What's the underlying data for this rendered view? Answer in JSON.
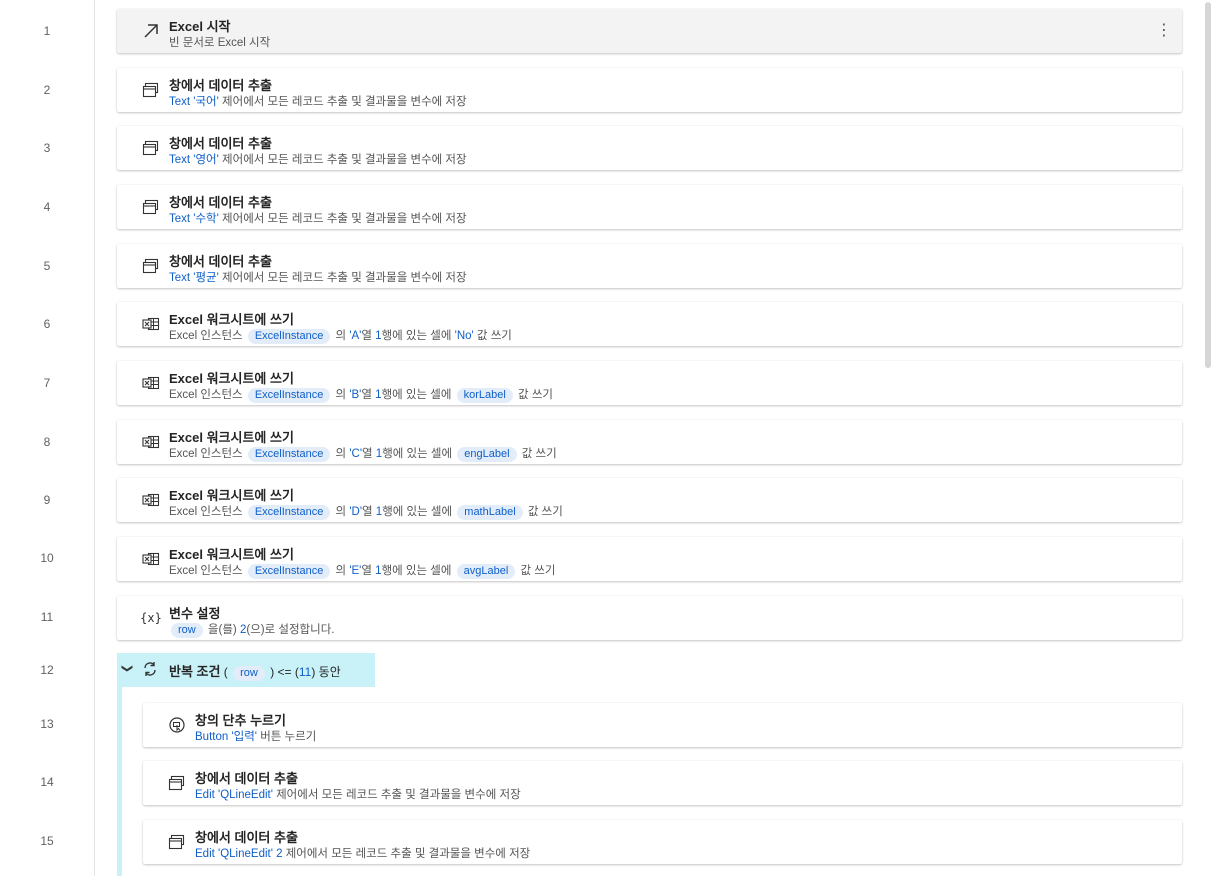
{
  "line_numbers": [
    "1",
    "2",
    "3",
    "4",
    "5",
    "6",
    "7",
    "8",
    "9",
    "10",
    "11",
    "12",
    "13",
    "14",
    "15"
  ],
  "actions": [
    {
      "title": "Excel 시작",
      "icon": "launch-arrow-icon",
      "desc": [
        {
          "t": "text",
          "v": "빈 문서로 Excel 시작"
        }
      ]
    },
    {
      "title": "창에서 데이터 추출",
      "icon": "window-icon",
      "desc": [
        {
          "t": "blue",
          "v": "Text '국어'"
        },
        {
          "t": "text",
          "v": " 제어에서 모든 레코드 추출 및 결과물을  변수에 저장"
        }
      ]
    },
    {
      "title": "창에서 데이터 추출",
      "icon": "window-icon",
      "desc": [
        {
          "t": "blue",
          "v": "Text '영어'"
        },
        {
          "t": "text",
          "v": " 제어에서 모든 레코드 추출 및 결과물을  변수에 저장"
        }
      ]
    },
    {
      "title": "창에서 데이터 추출",
      "icon": "window-icon",
      "desc": [
        {
          "t": "blue",
          "v": "Text '수학'"
        },
        {
          "t": "text",
          "v": " 제어에서 모든 레코드 추출 및 결과물을  변수에 저장"
        }
      ]
    },
    {
      "title": "창에서 데이터 추출",
      "icon": "window-icon",
      "desc": [
        {
          "t": "blue",
          "v": "Text '평균'"
        },
        {
          "t": "text",
          "v": " 제어에서 모든 레코드 추출 및 결과물을  변수에 저장"
        }
      ]
    },
    {
      "title": "Excel 워크시트에 쓰기",
      "icon": "excel-icon",
      "desc": [
        {
          "t": "text",
          "v": "Excel 인스턴스 "
        },
        {
          "t": "chip",
          "v": "ExcelInstance"
        },
        {
          "t": "text",
          "v": " 의 "
        },
        {
          "t": "blue",
          "v": "'A'"
        },
        {
          "t": "text",
          "v": "열 "
        },
        {
          "t": "blue",
          "v": "1"
        },
        {
          "t": "text",
          "v": "행에 있는 셀에 "
        },
        {
          "t": "blue",
          "v": "'No'"
        },
        {
          "t": "text",
          "v": " 값 쓰기"
        }
      ]
    },
    {
      "title": "Excel 워크시트에 쓰기",
      "icon": "excel-icon",
      "desc": [
        {
          "t": "text",
          "v": "Excel 인스턴스 "
        },
        {
          "t": "chip",
          "v": "ExcelInstance"
        },
        {
          "t": "text",
          "v": " 의 "
        },
        {
          "t": "blue",
          "v": "'B'"
        },
        {
          "t": "text",
          "v": "열 "
        },
        {
          "t": "blue",
          "v": "1"
        },
        {
          "t": "text",
          "v": "행에 있는 셀에 "
        },
        {
          "t": "chip",
          "v": "korLabel"
        },
        {
          "t": "text",
          "v": " 값 쓰기"
        }
      ]
    },
    {
      "title": "Excel 워크시트에 쓰기",
      "icon": "excel-icon",
      "desc": [
        {
          "t": "text",
          "v": "Excel 인스턴스 "
        },
        {
          "t": "chip",
          "v": "ExcelInstance"
        },
        {
          "t": "text",
          "v": " 의 "
        },
        {
          "t": "blue",
          "v": "'C'"
        },
        {
          "t": "text",
          "v": "열 "
        },
        {
          "t": "blue",
          "v": "1"
        },
        {
          "t": "text",
          "v": "행에 있는 셀에 "
        },
        {
          "t": "chip",
          "v": "engLabel"
        },
        {
          "t": "text",
          "v": " 값 쓰기"
        }
      ]
    },
    {
      "title": "Excel 워크시트에 쓰기",
      "icon": "excel-icon",
      "desc": [
        {
          "t": "text",
          "v": "Excel 인스턴스 "
        },
        {
          "t": "chip",
          "v": "ExcelInstance"
        },
        {
          "t": "text",
          "v": " 의 "
        },
        {
          "t": "blue",
          "v": "'D'"
        },
        {
          "t": "text",
          "v": "열 "
        },
        {
          "t": "blue",
          "v": "1"
        },
        {
          "t": "text",
          "v": "행에 있는 셀에 "
        },
        {
          "t": "chip",
          "v": "mathLabel"
        },
        {
          "t": "text",
          "v": " 값 쓰기"
        }
      ]
    },
    {
      "title": "Excel 워크시트에 쓰기",
      "icon": "excel-icon",
      "desc": [
        {
          "t": "text",
          "v": "Excel 인스턴스 "
        },
        {
          "t": "chip",
          "v": "ExcelInstance"
        },
        {
          "t": "text",
          "v": " 의 "
        },
        {
          "t": "blue",
          "v": "'E'"
        },
        {
          "t": "text",
          "v": "열 "
        },
        {
          "t": "blue",
          "v": "1"
        },
        {
          "t": "text",
          "v": "행에 있는 셀에 "
        },
        {
          "t": "chip",
          "v": "avgLabel"
        },
        {
          "t": "text",
          "v": " 값 쓰기"
        }
      ]
    },
    {
      "title": "변수 설정",
      "icon": "variable-icon",
      "desc": [
        {
          "t": "chip",
          "v": "row"
        },
        {
          "t": "text",
          "v": " 을(를) "
        },
        {
          "t": "blue",
          "v": "2"
        },
        {
          "t": "text",
          "v": "(으)로 설정합니다."
        }
      ]
    }
  ],
  "loop": {
    "title": "반복 조건",
    "desc": [
      {
        "t": "text",
        "v": " ( "
      },
      {
        "t": "chip",
        "v": "row"
      },
      {
        "t": "text",
        "v": " ) <= ("
      },
      {
        "t": "blue",
        "v": "11"
      },
      {
        "t": "text",
        "v": ") 동안"
      }
    ]
  },
  "loop_actions": [
    {
      "title": "창의 단추 누르기",
      "icon": "click-button-icon",
      "desc": [
        {
          "t": "blue",
          "v": "Button '입력'"
        },
        {
          "t": "text",
          "v": " 버튼 누르기"
        }
      ]
    },
    {
      "title": "창에서 데이터 추출",
      "icon": "window-icon",
      "desc": [
        {
          "t": "blue",
          "v": "Edit 'QLineEdit'"
        },
        {
          "t": "text",
          "v": " 제어에서 모든 레코드 추출 및 결과물을  변수에 저장"
        }
      ]
    },
    {
      "title": "창에서 데이터 추출",
      "icon": "window-icon",
      "desc": [
        {
          "t": "blue",
          "v": "Edit 'QLineEdit' 2"
        },
        {
          "t": "text",
          "v": " 제어에서 모든 레코드 추출 및 결과물을  변수에 저장"
        }
      ]
    }
  ],
  "more_icon": "⋮",
  "chevron_icon": "❯"
}
